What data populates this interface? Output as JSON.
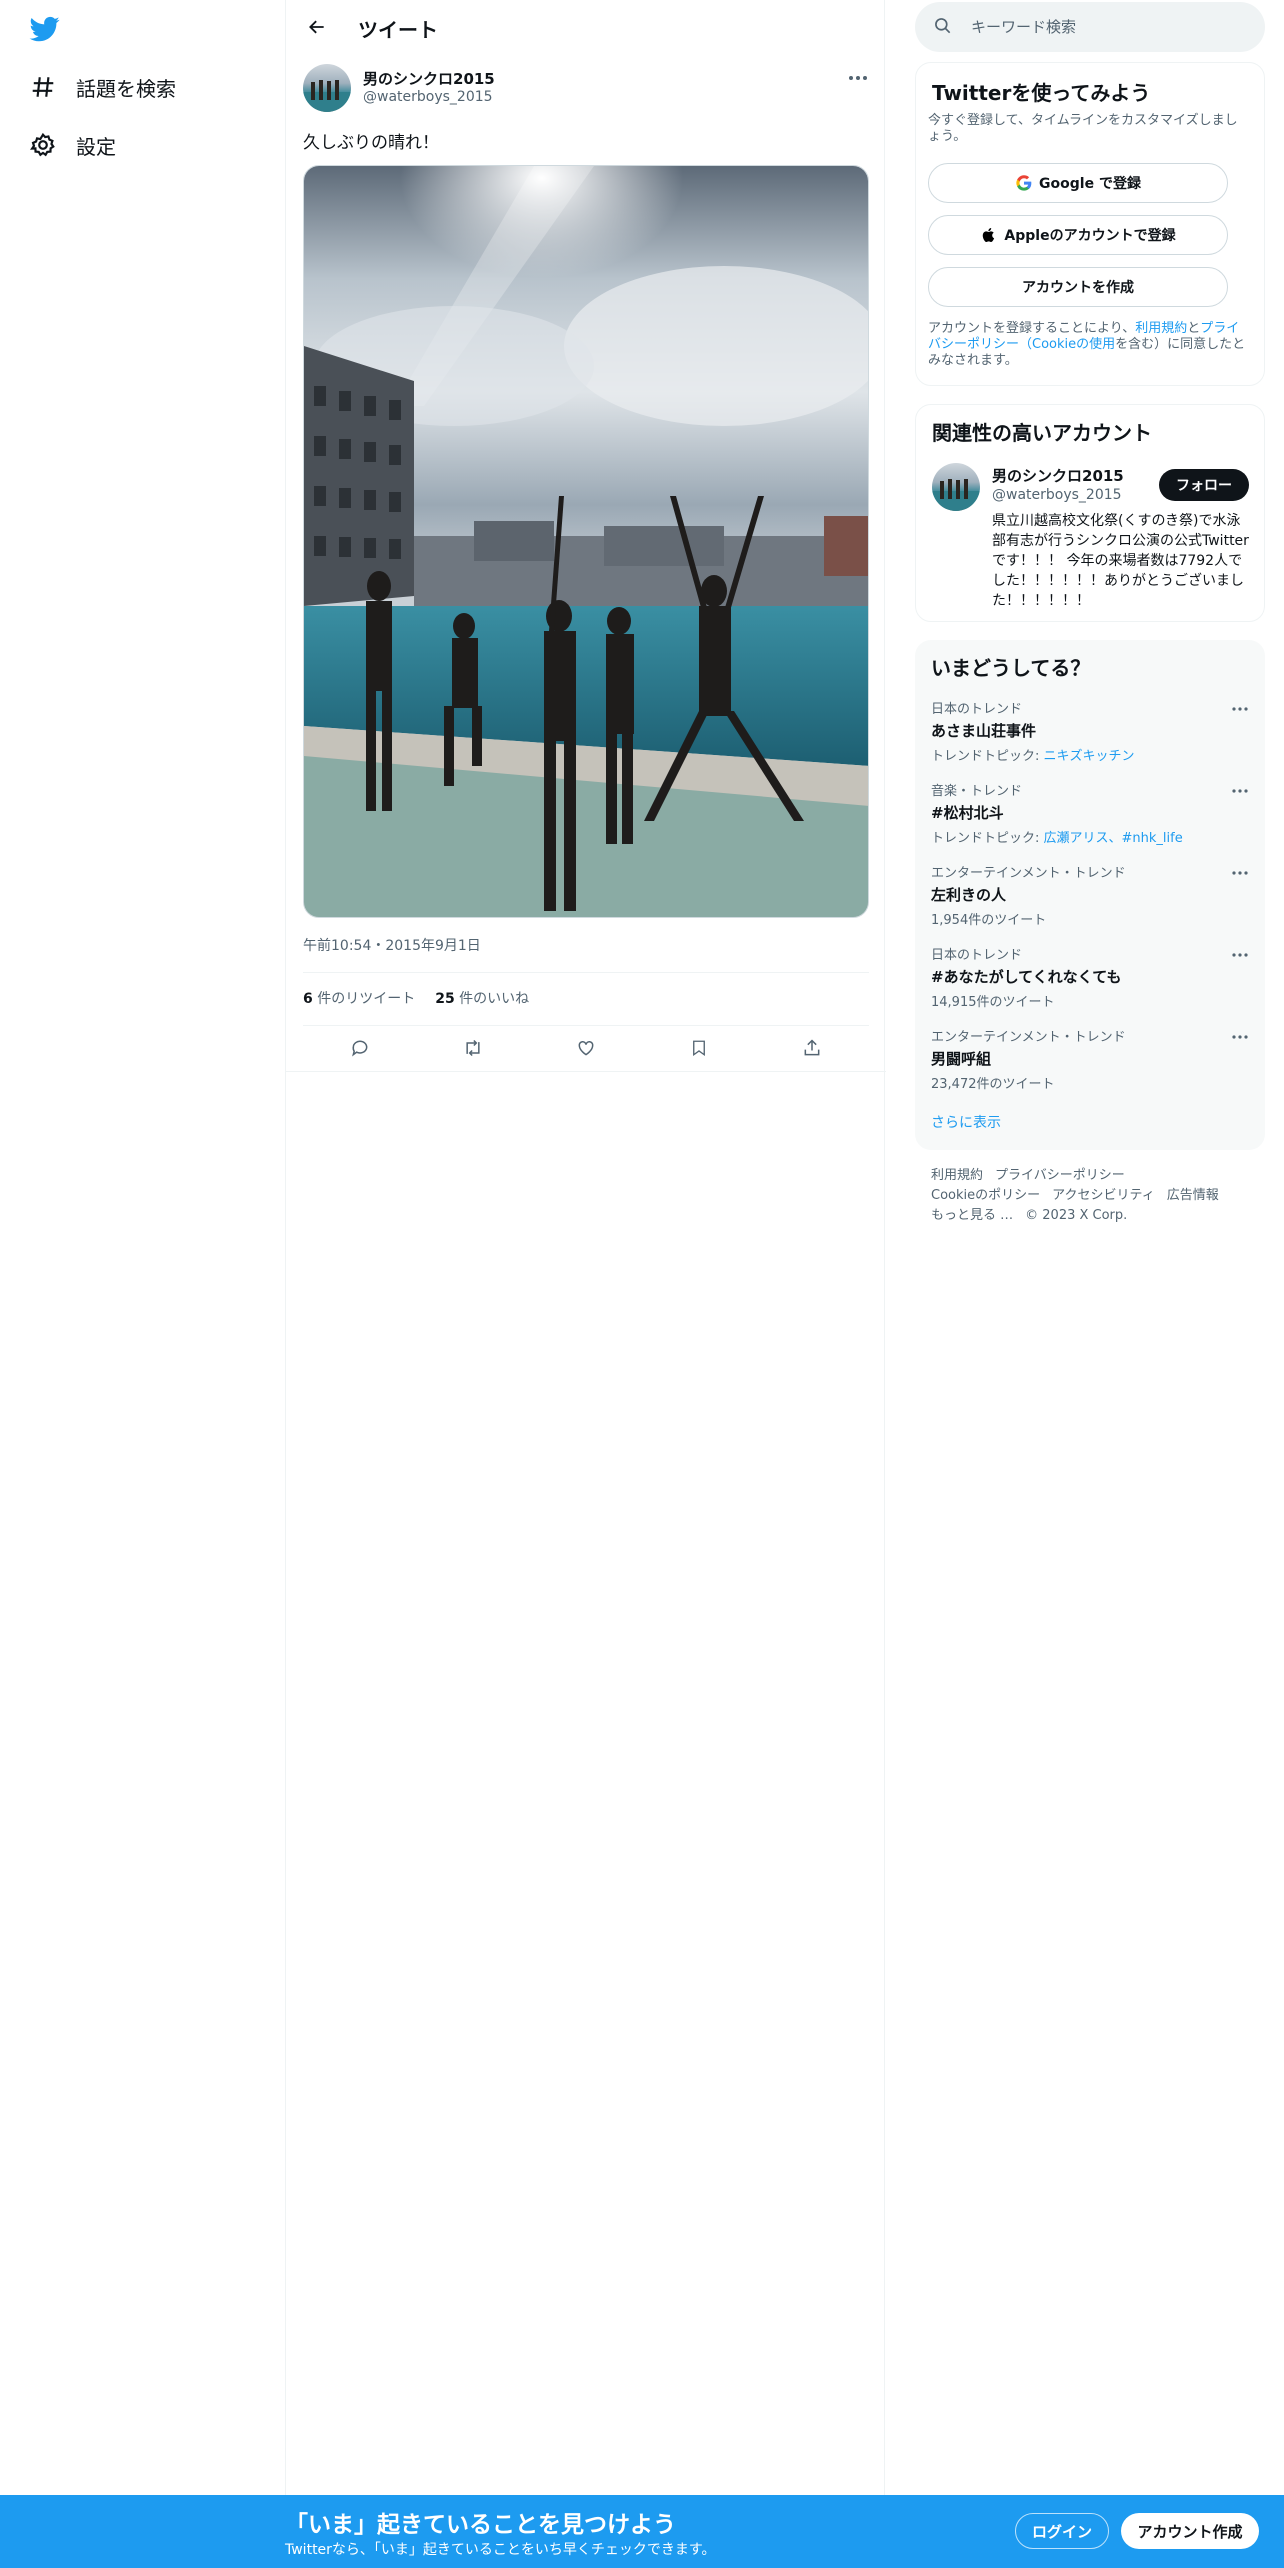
{
  "nav": {
    "logo": "twitter-bird-icon",
    "items": [
      {
        "label": "話題を検索",
        "icon": "hashtag-icon"
      },
      {
        "label": "設定",
        "icon": "gear-icon"
      }
    ]
  },
  "header": {
    "title": "ツイート"
  },
  "tweet": {
    "name": "男のシンクロ2015",
    "handle": "@waterboys_2015",
    "text": "久しぶりの晴れ！",
    "time": "午前10:54・2015年9月1日",
    "retweets_count": "6",
    "retweets_label": " 件のリツイート",
    "likes_count": "25",
    "likes_label": " 件のいいね"
  },
  "search": {
    "placeholder": "キーワード検索"
  },
  "signup_card": {
    "title": "Twitterを使ってみよう",
    "subtitle": "今すぐ登録して、タイムラインをカスタマイズしましょう。",
    "google_label": "Google で登録",
    "apple_label": "Appleのアカウントで登録",
    "create_label": "アカウントを作成",
    "legal_1": "アカウントを登録することにより、",
    "legal_terms": "利用規約",
    "legal_2": "と",
    "legal_privacy": "プライバシーポリシー（Cookieの使用",
    "legal_3": "を含む）に同意したとみなされます。"
  },
  "related": {
    "title": "関連性の高いアカウント",
    "name": "男のシンクロ2015",
    "handle": "@waterboys_2015",
    "follow_label": "フォロー",
    "bio": "県立川越高校文化祭(くすのき祭)で水泳部有志が行うシンクロ公演の公式Twitterです！！！ 今年の来場者数は7792人でした！！！！！！ありがとうございました！！！！！！"
  },
  "trends": {
    "title": "いまどうしてる？",
    "items": [
      {
        "category": "日本のトレンド",
        "name": "あさま山荘事件",
        "sub_prefix": "トレンドトピック: ",
        "sub_link": "ニキズキッチン"
      },
      {
        "category": "音楽・トレンド",
        "name": "#松村北斗",
        "sub_prefix": "トレンドトピック: ",
        "sub_link": "広瀬アリス、#nhk_life"
      },
      {
        "category": "エンターテインメント・トレンド",
        "name": "左利きの人",
        "sub_prefix": "1,954件のツイート",
        "sub_link": ""
      },
      {
        "category": "日本のトレンド",
        "name": "#あなたがしてくれなくても",
        "sub_prefix": "14,915件のツイート",
        "sub_link": ""
      },
      {
        "category": "エンターテインメント・トレンド",
        "name": "男闘呼組",
        "sub_prefix": "23,472件のツイート",
        "sub_link": ""
      }
    ],
    "show_more": "さらに表示"
  },
  "footer": {
    "links": [
      "利用規約",
      "プライバシーポリシー",
      "Cookieのポリシー",
      "アクセシビリティ",
      "広告情報",
      "もっと見る …"
    ],
    "copyright": "© 2023 X Corp."
  },
  "banner": {
    "title": "「いま」起きていることを見つけよう",
    "subtitle": "Twitterなら、「いま」起きていることをいち早くチェックできます。",
    "login_label": "ログイン",
    "signup_label": "アカウント作成"
  },
  "colors": {
    "accent": "#1d9bf0",
    "text": "#0f1419",
    "secondary": "#536471"
  }
}
